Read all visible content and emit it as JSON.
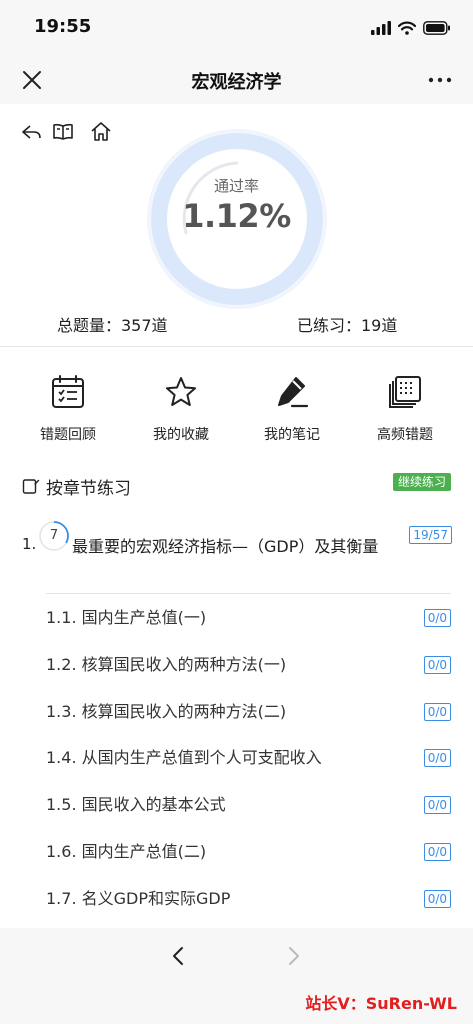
{
  "status_bar": {
    "time": "19:55"
  },
  "nav": {
    "title": "宏观经济学"
  },
  "top_icons": [
    "back-icon",
    "book-icon",
    "home-icon"
  ],
  "summary": {
    "pass_rate_label": "通过率",
    "pass_rate_value": "1.12%",
    "total_questions": "总题量：357道",
    "practiced": "已练习：19道"
  },
  "tools": [
    {
      "label": "错题回顾",
      "icon": "calendar-list-icon"
    },
    {
      "label": "我的收藏",
      "icon": "star-icon"
    },
    {
      "label": "我的笔记",
      "icon": "pen-icon"
    },
    {
      "label": "高频错题",
      "icon": "stacked-cards-icon"
    }
  ],
  "section": {
    "title": "按章节练习",
    "continue_label": "继续练习"
  },
  "chapter": {
    "number": "1.",
    "progress_value": "7",
    "title": "最重要的宏观经济指标—（GDP）及其衡量",
    "count": "19/57",
    "progress_fraction": 0.333
  },
  "sub_items": [
    {
      "label": "1.1. 国内生产总值(一)",
      "count": "0/0"
    },
    {
      "label": "1.2. 核算国民收入的两种方法(一)",
      "count": "0/0"
    },
    {
      "label": "1.3. 核算国民收入的两种方法(二)",
      "count": "0/0"
    },
    {
      "label": "1.4. 从国内生产总值到个人可支配收入",
      "count": "0/0"
    },
    {
      "label": "1.5. 国民收入的基本公式",
      "count": "0/0"
    },
    {
      "label": "1.6. 国内生产总值(二)",
      "count": "0/0"
    },
    {
      "label": "1.7. 名义GDP和实际GDP",
      "count": "0/0"
    }
  ],
  "watermark": "站长V：SuRen-WL",
  "colors": {
    "accent": "#3a8ee6",
    "continue": "#4caf50",
    "watermark": "#e02020",
    "ring": "#dbe8fb"
  }
}
